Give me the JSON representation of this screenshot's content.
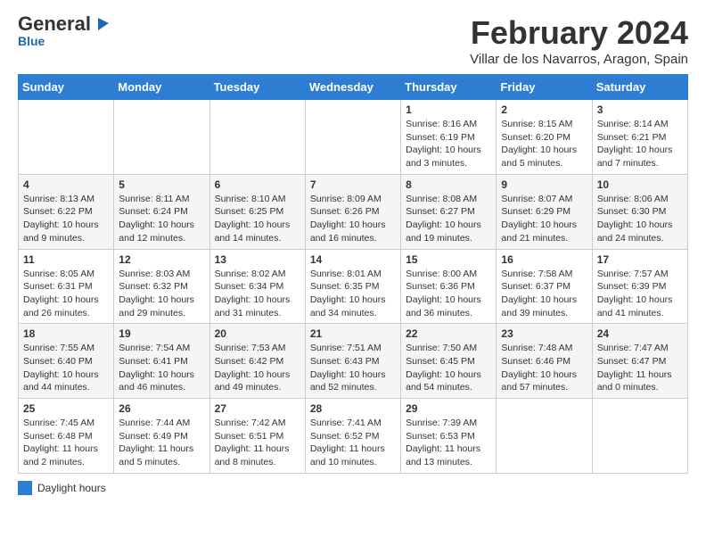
{
  "logo": {
    "line1": "General",
    "line2": "Blue"
  },
  "title": "February 2024",
  "subtitle": "Villar de los Navarros, Aragon, Spain",
  "days_of_week": [
    "Sunday",
    "Monday",
    "Tuesday",
    "Wednesday",
    "Thursday",
    "Friday",
    "Saturday"
  ],
  "weeks": [
    [
      {
        "day": "",
        "info": ""
      },
      {
        "day": "",
        "info": ""
      },
      {
        "day": "",
        "info": ""
      },
      {
        "day": "",
        "info": ""
      },
      {
        "day": "1",
        "info": "Sunrise: 8:16 AM\nSunset: 6:19 PM\nDaylight: 10 hours\nand 3 minutes."
      },
      {
        "day": "2",
        "info": "Sunrise: 8:15 AM\nSunset: 6:20 PM\nDaylight: 10 hours\nand 5 minutes."
      },
      {
        "day": "3",
        "info": "Sunrise: 8:14 AM\nSunset: 6:21 PM\nDaylight: 10 hours\nand 7 minutes."
      }
    ],
    [
      {
        "day": "4",
        "info": "Sunrise: 8:13 AM\nSunset: 6:22 PM\nDaylight: 10 hours\nand 9 minutes."
      },
      {
        "day": "5",
        "info": "Sunrise: 8:11 AM\nSunset: 6:24 PM\nDaylight: 10 hours\nand 12 minutes."
      },
      {
        "day": "6",
        "info": "Sunrise: 8:10 AM\nSunset: 6:25 PM\nDaylight: 10 hours\nand 14 minutes."
      },
      {
        "day": "7",
        "info": "Sunrise: 8:09 AM\nSunset: 6:26 PM\nDaylight: 10 hours\nand 16 minutes."
      },
      {
        "day": "8",
        "info": "Sunrise: 8:08 AM\nSunset: 6:27 PM\nDaylight: 10 hours\nand 19 minutes."
      },
      {
        "day": "9",
        "info": "Sunrise: 8:07 AM\nSunset: 6:29 PM\nDaylight: 10 hours\nand 21 minutes."
      },
      {
        "day": "10",
        "info": "Sunrise: 8:06 AM\nSunset: 6:30 PM\nDaylight: 10 hours\nand 24 minutes."
      }
    ],
    [
      {
        "day": "11",
        "info": "Sunrise: 8:05 AM\nSunset: 6:31 PM\nDaylight: 10 hours\nand 26 minutes."
      },
      {
        "day": "12",
        "info": "Sunrise: 8:03 AM\nSunset: 6:32 PM\nDaylight: 10 hours\nand 29 minutes."
      },
      {
        "day": "13",
        "info": "Sunrise: 8:02 AM\nSunset: 6:34 PM\nDaylight: 10 hours\nand 31 minutes."
      },
      {
        "day": "14",
        "info": "Sunrise: 8:01 AM\nSunset: 6:35 PM\nDaylight: 10 hours\nand 34 minutes."
      },
      {
        "day": "15",
        "info": "Sunrise: 8:00 AM\nSunset: 6:36 PM\nDaylight: 10 hours\nand 36 minutes."
      },
      {
        "day": "16",
        "info": "Sunrise: 7:58 AM\nSunset: 6:37 PM\nDaylight: 10 hours\nand 39 minutes."
      },
      {
        "day": "17",
        "info": "Sunrise: 7:57 AM\nSunset: 6:39 PM\nDaylight: 10 hours\nand 41 minutes."
      }
    ],
    [
      {
        "day": "18",
        "info": "Sunrise: 7:55 AM\nSunset: 6:40 PM\nDaylight: 10 hours\nand 44 minutes."
      },
      {
        "day": "19",
        "info": "Sunrise: 7:54 AM\nSunset: 6:41 PM\nDaylight: 10 hours\nand 46 minutes."
      },
      {
        "day": "20",
        "info": "Sunrise: 7:53 AM\nSunset: 6:42 PM\nDaylight: 10 hours\nand 49 minutes."
      },
      {
        "day": "21",
        "info": "Sunrise: 7:51 AM\nSunset: 6:43 PM\nDaylight: 10 hours\nand 52 minutes."
      },
      {
        "day": "22",
        "info": "Sunrise: 7:50 AM\nSunset: 6:45 PM\nDaylight: 10 hours\nand 54 minutes."
      },
      {
        "day": "23",
        "info": "Sunrise: 7:48 AM\nSunset: 6:46 PM\nDaylight: 10 hours\nand 57 minutes."
      },
      {
        "day": "24",
        "info": "Sunrise: 7:47 AM\nSunset: 6:47 PM\nDaylight: 11 hours\nand 0 minutes."
      }
    ],
    [
      {
        "day": "25",
        "info": "Sunrise: 7:45 AM\nSunset: 6:48 PM\nDaylight: 11 hours\nand 2 minutes."
      },
      {
        "day": "26",
        "info": "Sunrise: 7:44 AM\nSunset: 6:49 PM\nDaylight: 11 hours\nand 5 minutes."
      },
      {
        "day": "27",
        "info": "Sunrise: 7:42 AM\nSunset: 6:51 PM\nDaylight: 11 hours\nand 8 minutes."
      },
      {
        "day": "28",
        "info": "Sunrise: 7:41 AM\nSunset: 6:52 PM\nDaylight: 11 hours\nand 10 minutes."
      },
      {
        "day": "29",
        "info": "Sunrise: 7:39 AM\nSunset: 6:53 PM\nDaylight: 11 hours\nand 13 minutes."
      },
      {
        "day": "",
        "info": ""
      },
      {
        "day": "",
        "info": ""
      }
    ]
  ],
  "legend": {
    "color_label": "Daylight hours"
  }
}
